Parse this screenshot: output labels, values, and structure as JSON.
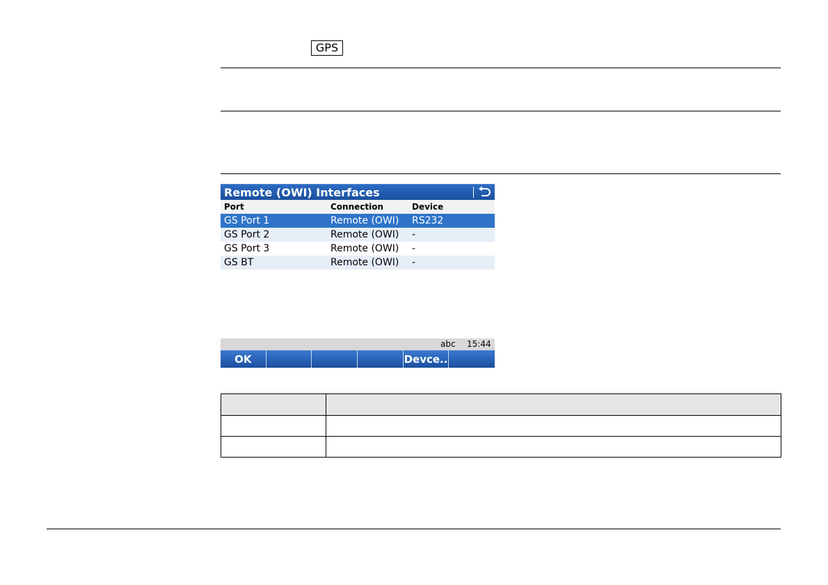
{
  "header": {
    "badge_label": "GPS"
  },
  "screen": {
    "title": "Remote (OWI) Interfaces",
    "back_icon": "back-arrow-icon",
    "columns": [
      "Port",
      "Connection",
      "Device"
    ],
    "rows": [
      {
        "port": "GS Port 1",
        "connection": "Remote (OWI)",
        "device": "RS232"
      },
      {
        "port": "GS Port 2",
        "connection": "Remote (OWI)",
        "device": "-"
      },
      {
        "port": "GS Port 3",
        "connection": "Remote (OWI)",
        "device": "-"
      },
      {
        "port": "GS BT",
        "connection": "Remote (OWI)",
        "device": "-"
      }
    ],
    "status": {
      "input_mode": "abc",
      "time": "15:44"
    },
    "fkeys": [
      "OK",
      "",
      "",
      "",
      "Devce..",
      ""
    ]
  },
  "colors": {
    "accent": "#2f74c8",
    "titlebar": "#1a4f9e"
  }
}
